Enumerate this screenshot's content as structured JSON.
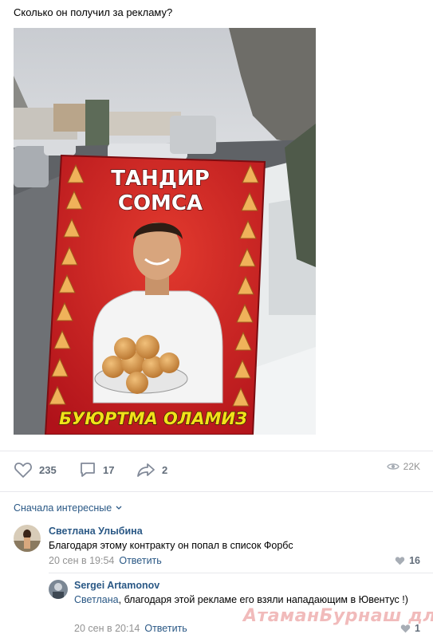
{
  "post": {
    "text": "Сколько он получил за рекламу?",
    "sign": {
      "title_line1": "ТАНДИР",
      "title_line2": "СОМСА",
      "bottom_text": "БУЮРТМА ОЛАМИЗ"
    }
  },
  "actions": {
    "likes": "235",
    "comments": "17",
    "shares": "2",
    "views": "22K"
  },
  "comments": {
    "sort_label": "Сначала интересные",
    "items": [
      {
        "author": "Светлана Улыбина",
        "text": "Благодаря этому контракту он попал в список Форбс",
        "date": "20 сен в 19:54",
        "reply_label": "Ответить",
        "likes": "16"
      },
      {
        "author": "Sergei Artamonov",
        "mention": "Светлана",
        "text": ", благодаря этой рекламе его взяли нападающим в Ювентус !)",
        "date": "20 сен в 20:14",
        "reply_label": "Ответить",
        "likes": "1"
      }
    ]
  },
  "watermark": "АтаманБурнаш для ЯП",
  "colors": {
    "link": "#2a5885",
    "muted": "#939393",
    "sign_red": "#c8161c",
    "sign_yellow": "#f2e11a"
  }
}
